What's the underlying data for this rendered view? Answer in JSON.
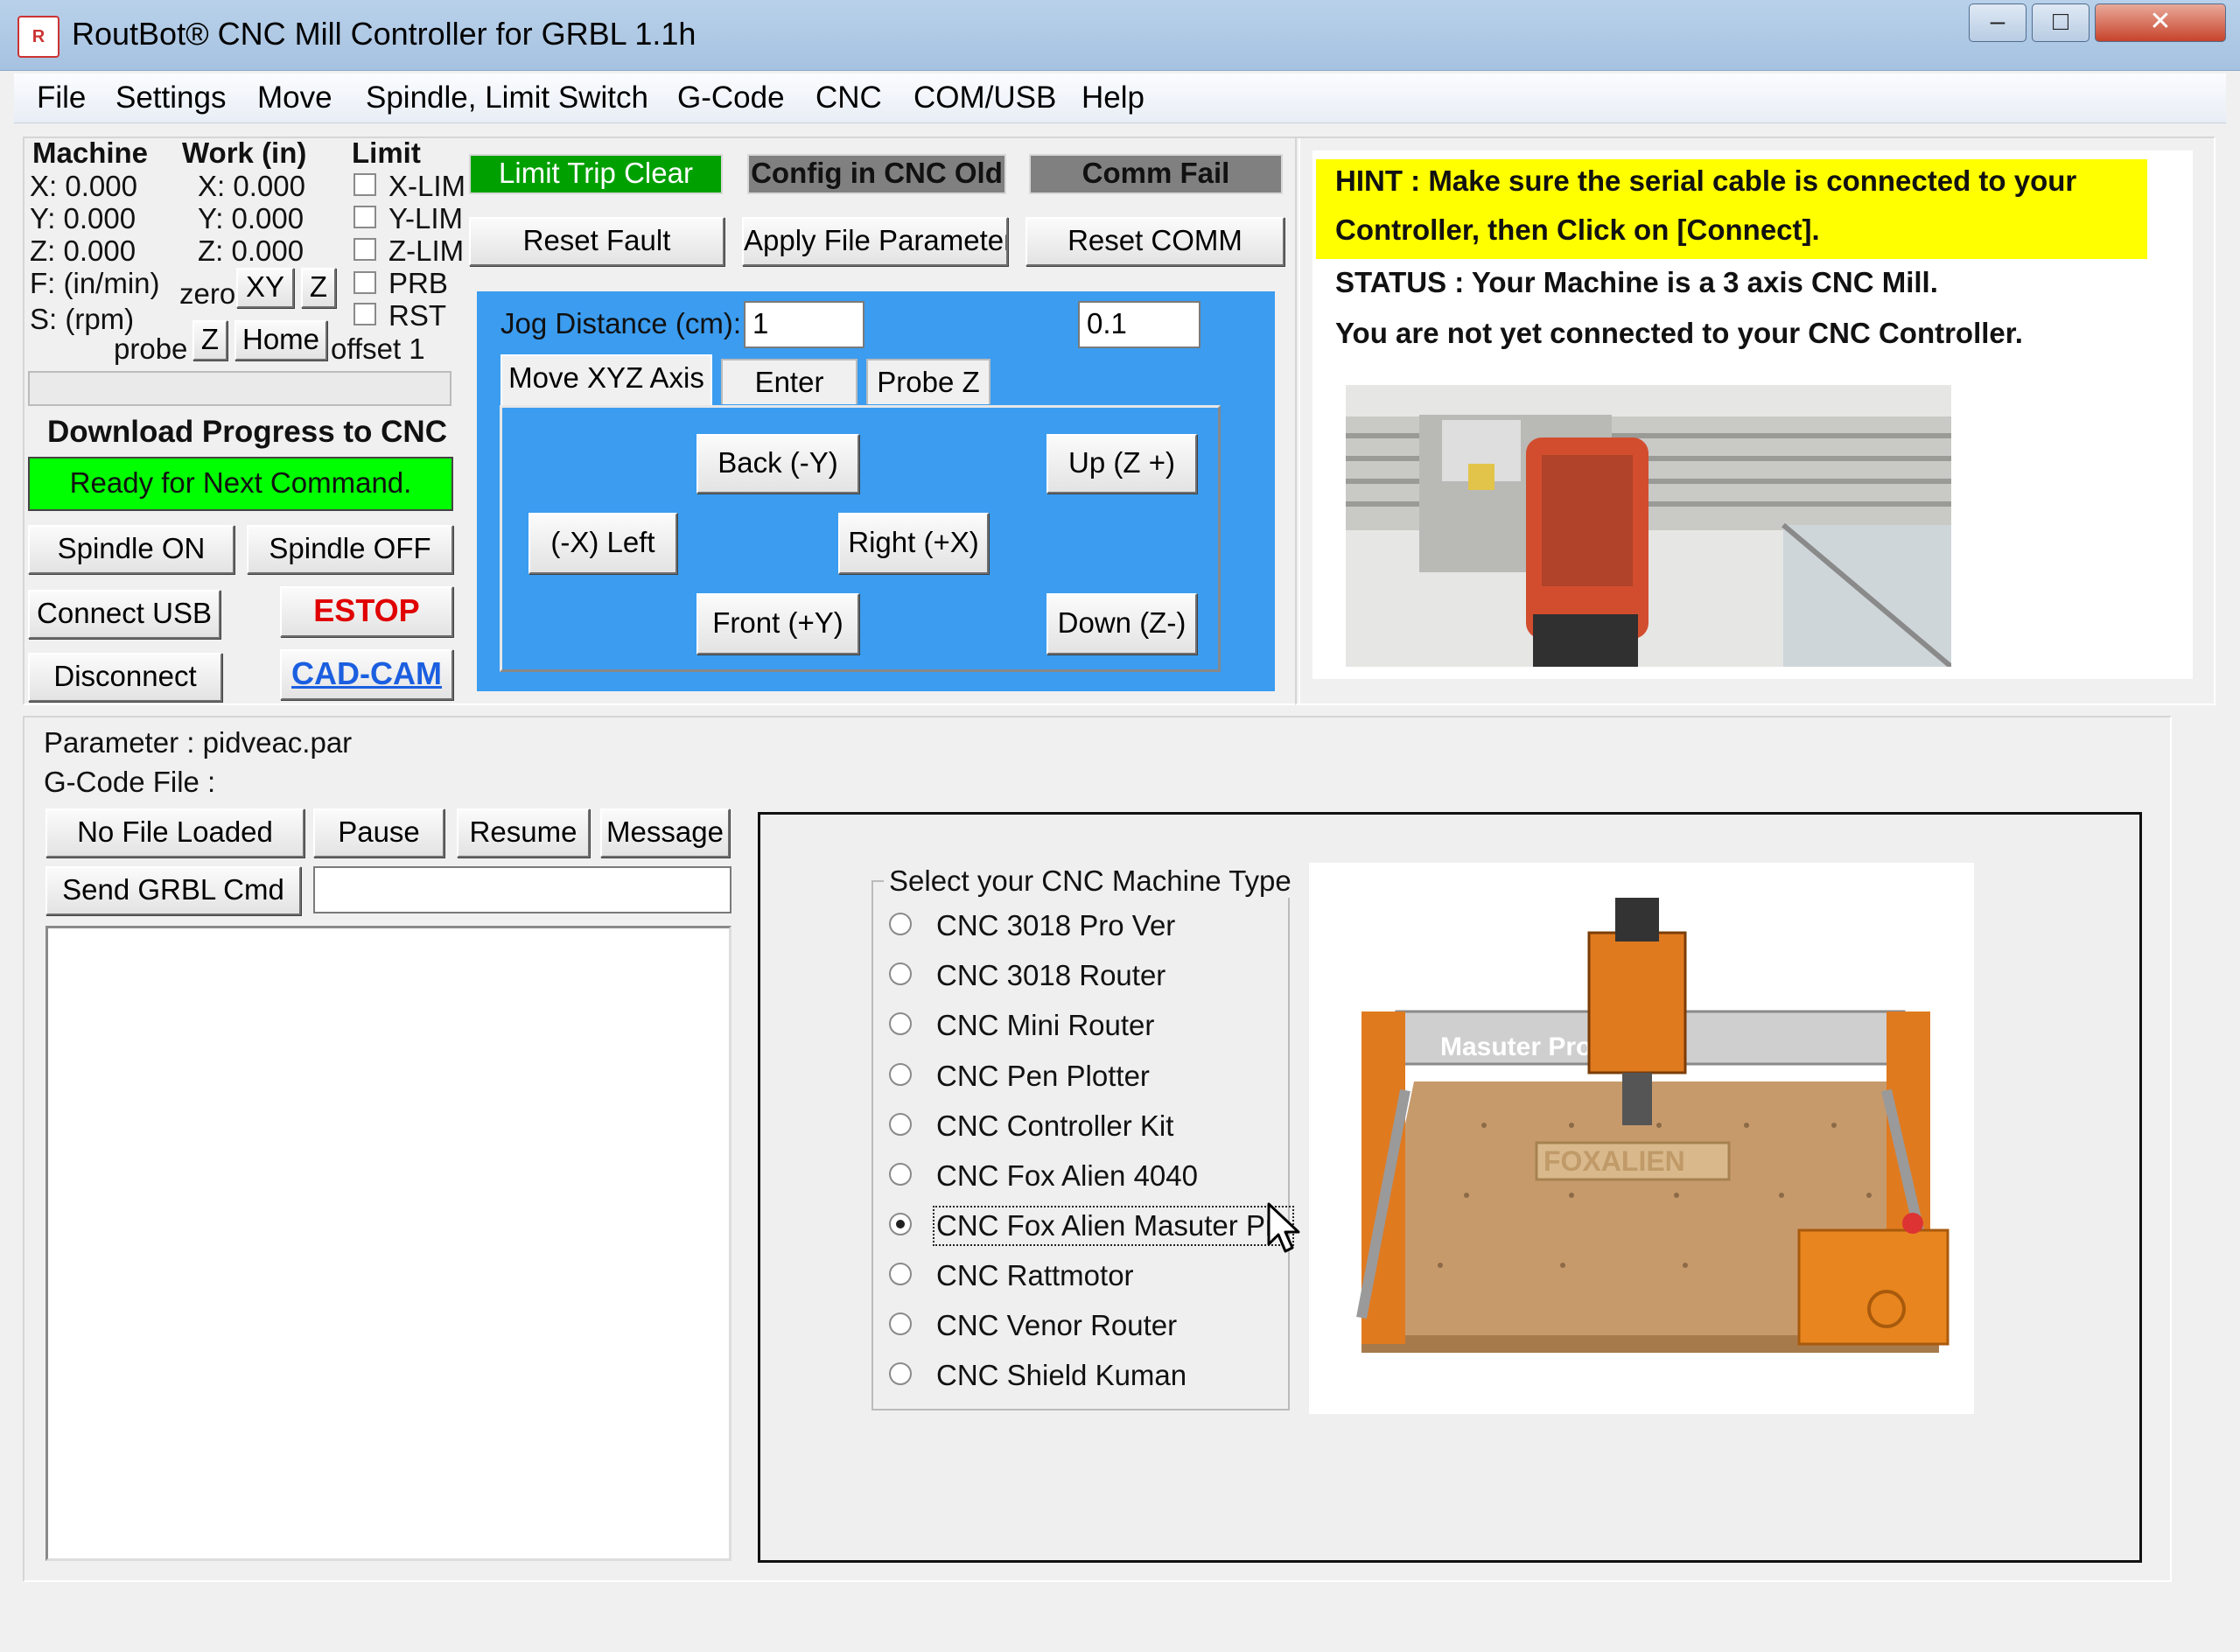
{
  "window": {
    "title": "RoutBot® CNC Mill Controller for GRBL 1.1h",
    "icon_text": "R",
    "controls": {
      "minimize": "‒",
      "maximize": "□",
      "close": "✕"
    }
  },
  "menu": [
    "File",
    "Settings",
    "Move",
    "Spindle, Limit Switch",
    "G-Code",
    "CNC",
    "COM/USB",
    "Help"
  ],
  "position": {
    "machine_header": "Machine",
    "work_header": "Work (in)",
    "limit_header": "Limit",
    "machine": {
      "x": "X: 0.000",
      "y": "Y: 0.000",
      "z": "Z: 0.000"
    },
    "work": {
      "x": "X: 0.000",
      "y": "Y: 0.000",
      "z": "Z: 0.000"
    },
    "feed_label": "F: (in/min)",
    "speed_label": "S: (rpm)",
    "zero_label": "zero",
    "zero_xy": "XY",
    "zero_z": "Z",
    "probe_label": "probe",
    "probe_z": "Z",
    "home": "Home",
    "offset": "offset 1",
    "limits": [
      "X-LIM",
      "Y-LIM",
      "Z-LIM",
      "PRB",
      "RST"
    ]
  },
  "progress": {
    "title": "Download Progress to CNC",
    "status": "Ready for Next Command."
  },
  "left_buttons": {
    "spindle_on": "Spindle ON",
    "spindle_off": "Spindle OFF",
    "connect_usb": "Connect USB",
    "estop": "ESTOP",
    "disconnect": "Disconnect",
    "cad_cam": "CAD-CAM"
  },
  "status_indicators": {
    "limit": "Limit Trip Clear",
    "config": "Config in CNC Old",
    "comm": "Comm Fail"
  },
  "actions": {
    "reset_fault": "Reset Fault",
    "apply_params": "Apply File Parameters",
    "reset_comm": "Reset COMM"
  },
  "jog": {
    "distance_label": "Jog Distance (cm):",
    "distance_value": "1",
    "distance_value2": "0.1",
    "tabs": [
      "Move XYZ Axis",
      "Enter XYZ",
      "Probe Z"
    ],
    "back": "Back  (-Y)",
    "up": "Up (Z +)",
    "left": "(-X) Left",
    "right": "Right  (+X)",
    "front": "Front  (+Y)",
    "down": "Down (Z-)"
  },
  "hint": {
    "line1": "HINT    : Make sure the serial cable is connected to your",
    "line2": "Controller, then Click on [Connect].",
    "status1": "STATUS : Your Machine is a 3 axis CNC Mill.",
    "status2": "You are not yet connected to your CNC Controller."
  },
  "files": {
    "parameter": "Parameter : pidveac.par",
    "gcode": "G-Code File :",
    "no_file": "No File Loaded",
    "pause": "Pause",
    "resume": "Resume",
    "message": "Message",
    "send_cmd": "Send GRBL Cmd",
    "cmd_value": ""
  },
  "machine_type": {
    "title": "Select your CNC Machine Type",
    "options": [
      "CNC 3018 Pro Ver",
      "CNC 3018 Router",
      "CNC Mini Router",
      "CNC Pen Plotter",
      "CNC Controller Kit",
      "CNC Fox Alien 4040",
      "CNC Fox Alien Masuter Pro",
      "CNC Rattmotor",
      "CNC Venor Router",
      "CNC Shield Kuman"
    ],
    "selected_index": 6,
    "image_brand_text": "Masuter Pro",
    "image_bed_text": "FOXALIEN"
  },
  "colors": {
    "jog_panel": "#3b9cf0",
    "hint_bg": "#ffff00",
    "ready_green": "#00ff00",
    "indicator_green": "#00a000",
    "indicator_grey": "#808080",
    "estop_red": "#e00000",
    "link_blue": "#1b5fe0"
  }
}
